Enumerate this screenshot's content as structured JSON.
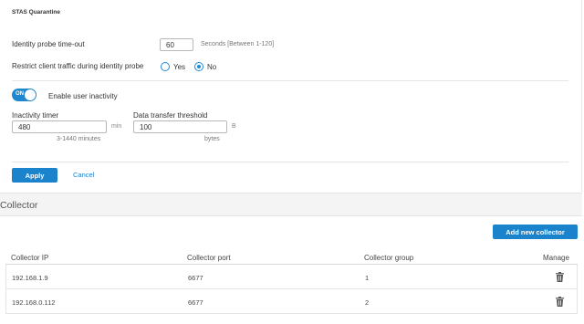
{
  "quarantine": {
    "title": "STAS Quarantine",
    "probe_timeout_label": "Identity probe time-out",
    "probe_timeout_value": "60",
    "probe_timeout_hint": "Seconds [Between 1-120]",
    "restrict_label": "Restrict client traffic during identity probe",
    "restrict_yes": "Yes",
    "restrict_no": "No",
    "restrict_selected": "No"
  },
  "inactivity": {
    "toggle_label": "ON",
    "toggle_state": "on",
    "enable_label": "Enable user inactivity",
    "timer_label": "Inactivity timer",
    "timer_value": "480",
    "timer_unit": "min",
    "timer_hint": "3-1440 minutes",
    "threshold_label": "Data transfer threshold",
    "threshold_value": "100",
    "threshold_unit": "B",
    "threshold_hint": "bytes"
  },
  "actions": {
    "apply": "Apply",
    "cancel": "Cancel"
  },
  "collector": {
    "section_title": "Collector",
    "add_button": "Add new collector",
    "columns": {
      "ip": "Collector IP",
      "port": "Collector port",
      "group": "Collector group",
      "manage": "Manage"
    },
    "rows": [
      {
        "ip": "192.168.1.9",
        "port": "6677",
        "group": "1"
      },
      {
        "ip": "192.168.0.112",
        "port": "6677",
        "group": "2"
      }
    ]
  },
  "colors": {
    "accent": "#1b82cc",
    "border": "#e4e4e4"
  },
  "icons": {
    "manage": "trash-icon"
  }
}
